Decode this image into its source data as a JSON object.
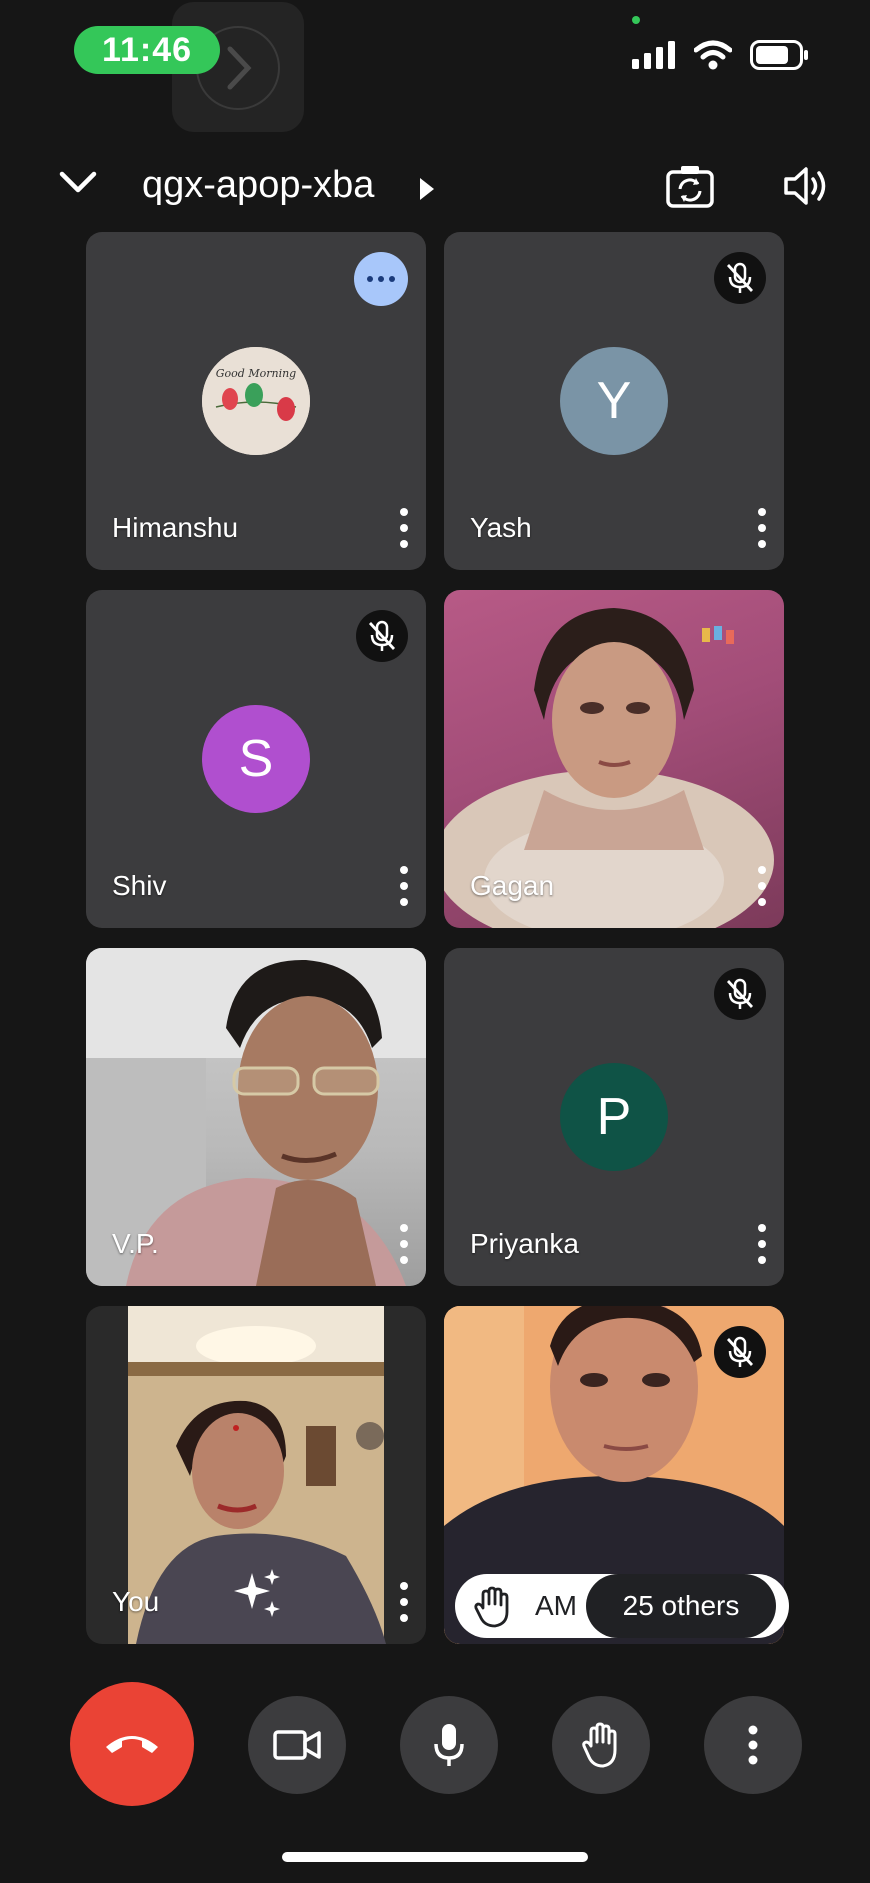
{
  "status_bar": {
    "time": "11:46"
  },
  "header": {
    "meeting_code": "qgx-apop-xba"
  },
  "participants": [
    {
      "name": "Himanshu",
      "muted": false,
      "avatar_type": "image"
    },
    {
      "name": "Yash",
      "muted": true,
      "initial": "Y",
      "avatar_color": "#7a94a6"
    },
    {
      "name": "Shiv",
      "muted": true,
      "initial": "S",
      "avatar_color": "#b04fcf"
    },
    {
      "name": "Gagan",
      "muted": false,
      "avatar_type": "video"
    },
    {
      "name": "V.P.",
      "muted": false,
      "avatar_type": "video"
    },
    {
      "name": "Priyanka",
      "muted": true,
      "initial": "P",
      "avatar_color": "#0f5346"
    },
    {
      "name": "You",
      "muted": false,
      "avatar_type": "video"
    },
    {
      "name": "",
      "muted": true,
      "avatar_type": "video"
    }
  ],
  "hand_raise": {
    "name": "AM",
    "others": "25 others"
  },
  "colors": {
    "end_call": "#ea4335",
    "background": "#161616",
    "tile": "#3c3c3e",
    "time_pill": "#34c759"
  }
}
